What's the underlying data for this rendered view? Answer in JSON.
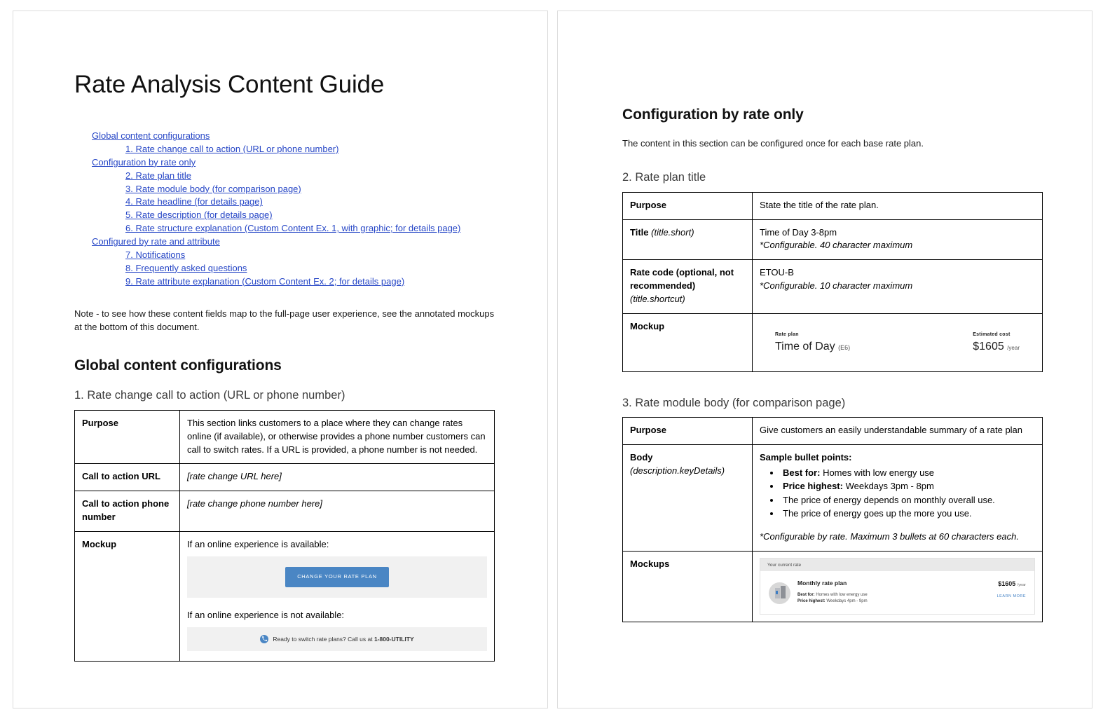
{
  "document": {
    "title": "Rate Analysis Content Guide"
  },
  "toc": {
    "entries": [
      {
        "label": "Global content configurations",
        "level": 1
      },
      {
        "label": "1. Rate change call to action (URL or phone number)",
        "level": 2
      },
      {
        "label": "Configuration by rate only",
        "level": 1
      },
      {
        "label": "2. Rate plan title",
        "level": 2
      },
      {
        "label": "3. Rate module body (for comparison page)",
        "level": 2
      },
      {
        "label": "4. Rate headline (for details page)",
        "level": 2
      },
      {
        "label": "5. Rate description (for details page)",
        "level": 2
      },
      {
        "label": "6. Rate structure explanation (Custom Content Ex. 1, with graphic; for details page)",
        "level": 2
      },
      {
        "label": "Configured by rate and attribute",
        "level": 1
      },
      {
        "label": "7. Notifications",
        "level": 2
      },
      {
        "label": "8. Frequently asked questions",
        "level": 2
      },
      {
        "label": "9. Rate attribute explanation (Custom Content Ex. 2; for details page)",
        "level": 2
      }
    ]
  },
  "note": "Note - to see how these content fields map to the full-page user experience, see the annotated mockups at the bottom of this document.",
  "section_global": {
    "heading": "Global content configurations",
    "subheading": "1. Rate change call to action (URL or phone number)",
    "rows": {
      "purpose_label": "Purpose",
      "purpose_value": "This section links customers to a place where they can change rates online (if available), or otherwise provides a phone number customers can call to switch rates. If a URL is provided, a phone number is not needed.",
      "url_label": "Call to action URL",
      "url_value": "[rate change URL here]",
      "phone_label": "Call to action phone number",
      "phone_value": "[rate change phone number here]",
      "mockup_label": "Mockup"
    },
    "mockup": {
      "caption_available": "If an online experience is available:",
      "cta_button": "CHANGE YOUR RATE PLAN",
      "caption_unavailable": "If an online experience is not available:",
      "phone_banner_prefix": "Ready to switch rate plans? Call us at ",
      "phone_banner_number": "1-800-UTILITY"
    }
  },
  "section_rate_only": {
    "heading": "Configuration by rate only",
    "intro": "The content in this section can be configured once for each base rate plan.",
    "subsection_2": {
      "subheading": "2. Rate plan title",
      "purpose_label": "Purpose",
      "purpose_value": "State the title of the rate plan.",
      "title_label": "Title",
      "title_label_sub": "(title.short)",
      "title_value": "Time of Day 3-8pm",
      "title_note": "*Configurable. 40 character maximum",
      "ratecode_label": "Rate code (optional, not recommended)",
      "ratecode_label_sub": "(title.shortcut)",
      "ratecode_value": "ETOU-B",
      "ratecode_note": "*Configurable. 10 character maximum",
      "mockup_label": "Mockup",
      "mockup": {
        "rate_plan_eyebrow": "Rate plan",
        "rate_plan_name": "Time of Day",
        "rate_plan_code": "(E6)",
        "cost_eyebrow": "Estimated cost",
        "cost_value": "$1605",
        "cost_unit": "/year"
      }
    },
    "subsection_3": {
      "subheading": "3. Rate module body (for comparison page)",
      "purpose_label": "Purpose",
      "purpose_value": "Give customers an easily understandable summary of a rate plan",
      "body_label": "Body",
      "body_label_sub": "(description.keyDetails)",
      "body_heading": "Sample bullet points:",
      "bullets": [
        {
          "bold": "Best for:",
          "rest": " Homes with low energy use"
        },
        {
          "bold": "Price highest:",
          "rest": " Weekdays 3pm - 8pm"
        },
        {
          "bold": "",
          "rest": "The price of energy depends on monthly overall use."
        },
        {
          "bold": "",
          "rest": "The price of energy goes up the more you use."
        }
      ],
      "body_note": "*Configurable by rate. Maximum 3 bullets at 60 characters each.",
      "mockups_label": "Mockups",
      "mockup": {
        "card_header": "Your current rate",
        "card_title": "Monthly rate plan",
        "line1_bold": "Best for:",
        "line1_rest": " Homes with low energy use",
        "line2_bold": "Price highest:",
        "line2_rest": " Weekdays 4pm - 9pm",
        "price_value": "$1605",
        "price_unit": "/year",
        "learn_more": "LEARN MORE"
      }
    }
  },
  "colors": {
    "link": "#2646c6",
    "accent_blue": "#4a86c4",
    "mock_band": "#f1f1f1"
  }
}
